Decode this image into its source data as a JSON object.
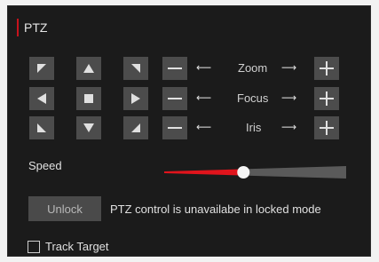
{
  "header": {
    "title": "PTZ"
  },
  "controls": {
    "zoom_label": "Zoom",
    "focus_label": "Focus",
    "iris_label": "Iris",
    "minus_symbol": "—",
    "plus_symbol": "+",
    "left_arrow": "⟵",
    "right_arrow": "⟶"
  },
  "speed": {
    "label": "Speed",
    "value_fraction": 0.43
  },
  "lock": {
    "button_label": "Unlock",
    "message": "PTZ control is unavailabe in locked mode"
  },
  "track": {
    "label": "Track Target",
    "checked": false
  },
  "colors": {
    "panel_bg": "#1b1b1b",
    "button_bg": "#4c4c4c",
    "accent": "#c7131d",
    "slider_active": "#e0141c",
    "slider_inactive": "#5a5a5a"
  }
}
